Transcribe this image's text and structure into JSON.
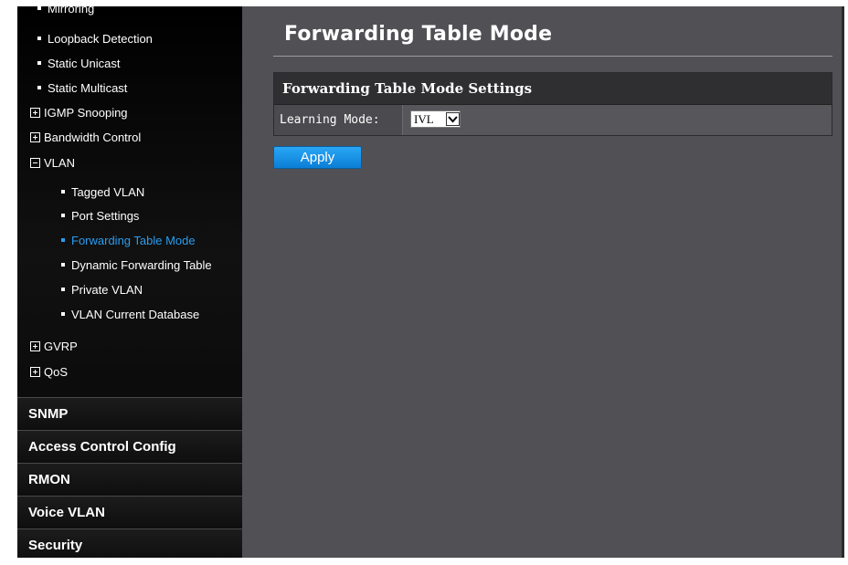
{
  "sidebar": {
    "items": [
      {
        "label": "Mirroring",
        "type": "sub",
        "top": 0
      },
      {
        "label": "Loopback Detection",
        "type": "sub"
      },
      {
        "label": "Static Unicast",
        "type": "sub"
      },
      {
        "label": "Static Multicast",
        "type": "sub"
      },
      {
        "label": "IGMP Snooping",
        "type": "group",
        "state": "collapsed"
      },
      {
        "label": "Bandwidth Control",
        "type": "group",
        "state": "collapsed"
      },
      {
        "label": "VLAN",
        "type": "group",
        "state": "expanded"
      },
      {
        "label": "Tagged VLAN",
        "type": "deep"
      },
      {
        "label": "Port Settings",
        "type": "deep"
      },
      {
        "label": "Forwarding Table Mode",
        "type": "deep",
        "active": true
      },
      {
        "label": "Dynamic Forwarding Table",
        "type": "deep"
      },
      {
        "label": "Private VLAN",
        "type": "deep"
      },
      {
        "label": "VLAN Current Database",
        "type": "deep"
      },
      {
        "label": "GVRP",
        "type": "group",
        "state": "collapsed"
      },
      {
        "label": "QoS",
        "type": "group",
        "state": "collapsed"
      }
    ],
    "sections": [
      "SNMP",
      "Access Control Config",
      "RMON",
      "Voice VLAN",
      "Security"
    ],
    "active_color": "#2a9cf0"
  },
  "main": {
    "title": "Forwarding Table Mode",
    "settings_header": "Forwarding Table Mode Settings",
    "learning_mode_label": "Learning Mode:",
    "learning_mode_value": "IVL",
    "apply_label": "Apply",
    "accent": "#1a94e8"
  }
}
